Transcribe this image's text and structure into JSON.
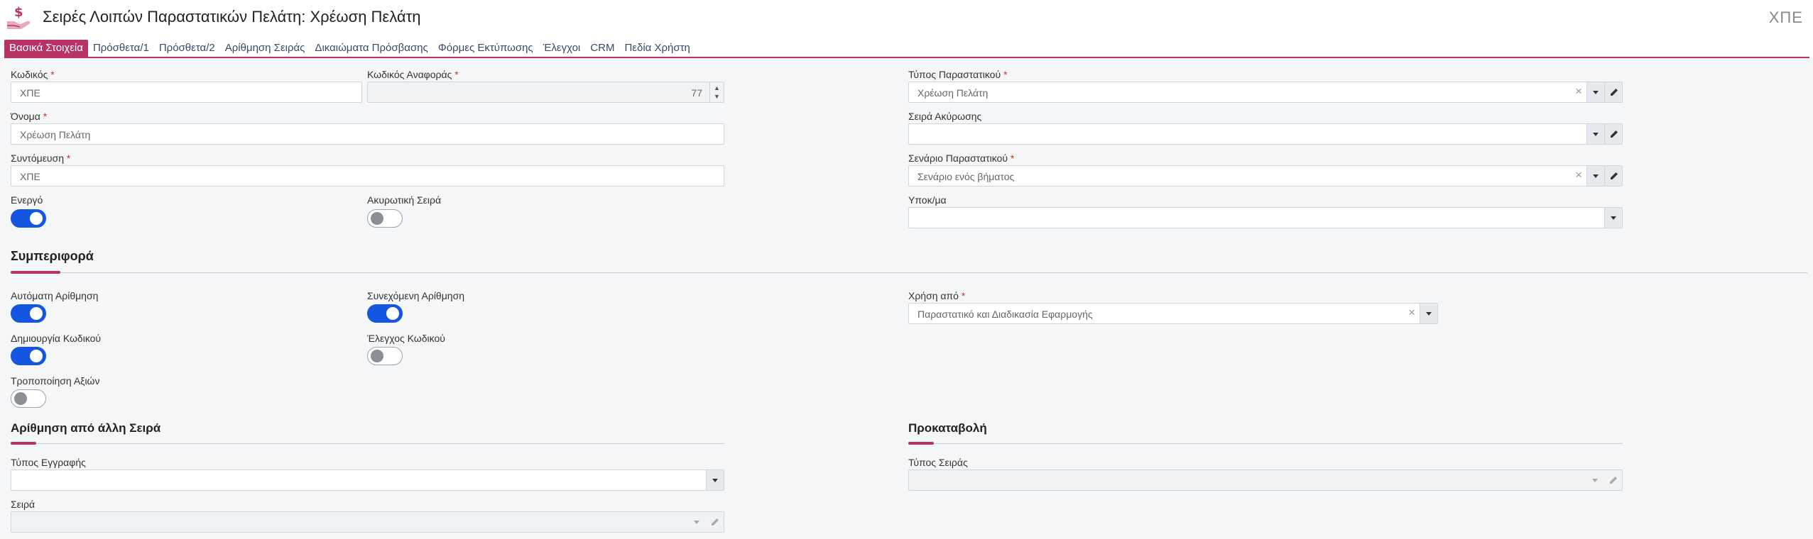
{
  "header": {
    "title": "Σειρές Λοιπών Παραστατικών Πελάτη: Χρέωση Πελάτη",
    "code": "ΧΠΕ",
    "icon": "hand-dollar-icon"
  },
  "tabs": [
    {
      "label": "Βασικά Στοιχεία",
      "active": true
    },
    {
      "label": "Πρόσθετα/1"
    },
    {
      "label": "Πρόσθετα/2"
    },
    {
      "label": "Αρίθμηση Σειράς"
    },
    {
      "label": "Δικαιώματα Πρόσβασης"
    },
    {
      "label": "Φόρμες Εκτύπωσης"
    },
    {
      "label": "Έλεγχοι"
    },
    {
      "label": "CRM"
    },
    {
      "label": "Πεδία Χρήστη"
    }
  ],
  "fields": {
    "code": {
      "label": "Κωδικός",
      "required": "*",
      "value": "ΧΠΕ"
    },
    "reference_code": {
      "label": "Κωδικός Αναφοράς",
      "required": "*",
      "value": "77"
    },
    "name": {
      "label": "Όνομα",
      "required": "*",
      "value": "Χρέωση Πελάτη"
    },
    "abbreviation": {
      "label": "Συντόμευση",
      "required": "*",
      "value": "ΧΠΕ"
    },
    "document_type": {
      "label": "Τύπος Παραστατικού",
      "required": "*",
      "value": "Χρέωση Πελάτη"
    },
    "cancel_series": {
      "label": "Σειρά Ακύρωσης",
      "value": ""
    },
    "document_scenario": {
      "label": "Σενάριο Παραστατικού",
      "required": "*",
      "value": "Σενάριο ενός βήματος"
    },
    "branch": {
      "label": "Υποκ/μα",
      "value": ""
    },
    "used_by": {
      "label": "Χρήση από",
      "required": "*",
      "value": "Παραστατικό και Διαδικασία Εφαρμογής"
    },
    "record_type": {
      "label": "Τύπος Εγγραφής",
      "value": ""
    },
    "series": {
      "label": "Σειρά",
      "value": ""
    },
    "series_type": {
      "label": "Τύπος Σειράς",
      "value": ""
    }
  },
  "toggles": {
    "active": {
      "label": "Ενεργό",
      "on": true
    },
    "cancelling_series": {
      "label": "Ακυρωτική Σειρά",
      "on": false
    },
    "auto_numbering": {
      "label": "Αυτόματη Αρίθμηση",
      "on": true
    },
    "continuous_numbering": {
      "label": "Συνεχόμενη Αρίθμηση",
      "on": true
    },
    "create_code": {
      "label": "Δημιουργία Κωδικού",
      "on": true
    },
    "check_code": {
      "label": "Έλεγχος Κωδικού",
      "on": false
    },
    "modify_values": {
      "label": "Τροποποίηση Αξιών",
      "on": false
    }
  },
  "sections": {
    "behavior": "Συμπεριφορά",
    "numbering_from_other": "Αρίθμηση από άλλη Σειρά",
    "advance_payment": "Προκαταβολή"
  },
  "colors": {
    "accent": "#b83265",
    "toggle_on": "#1556e0"
  }
}
